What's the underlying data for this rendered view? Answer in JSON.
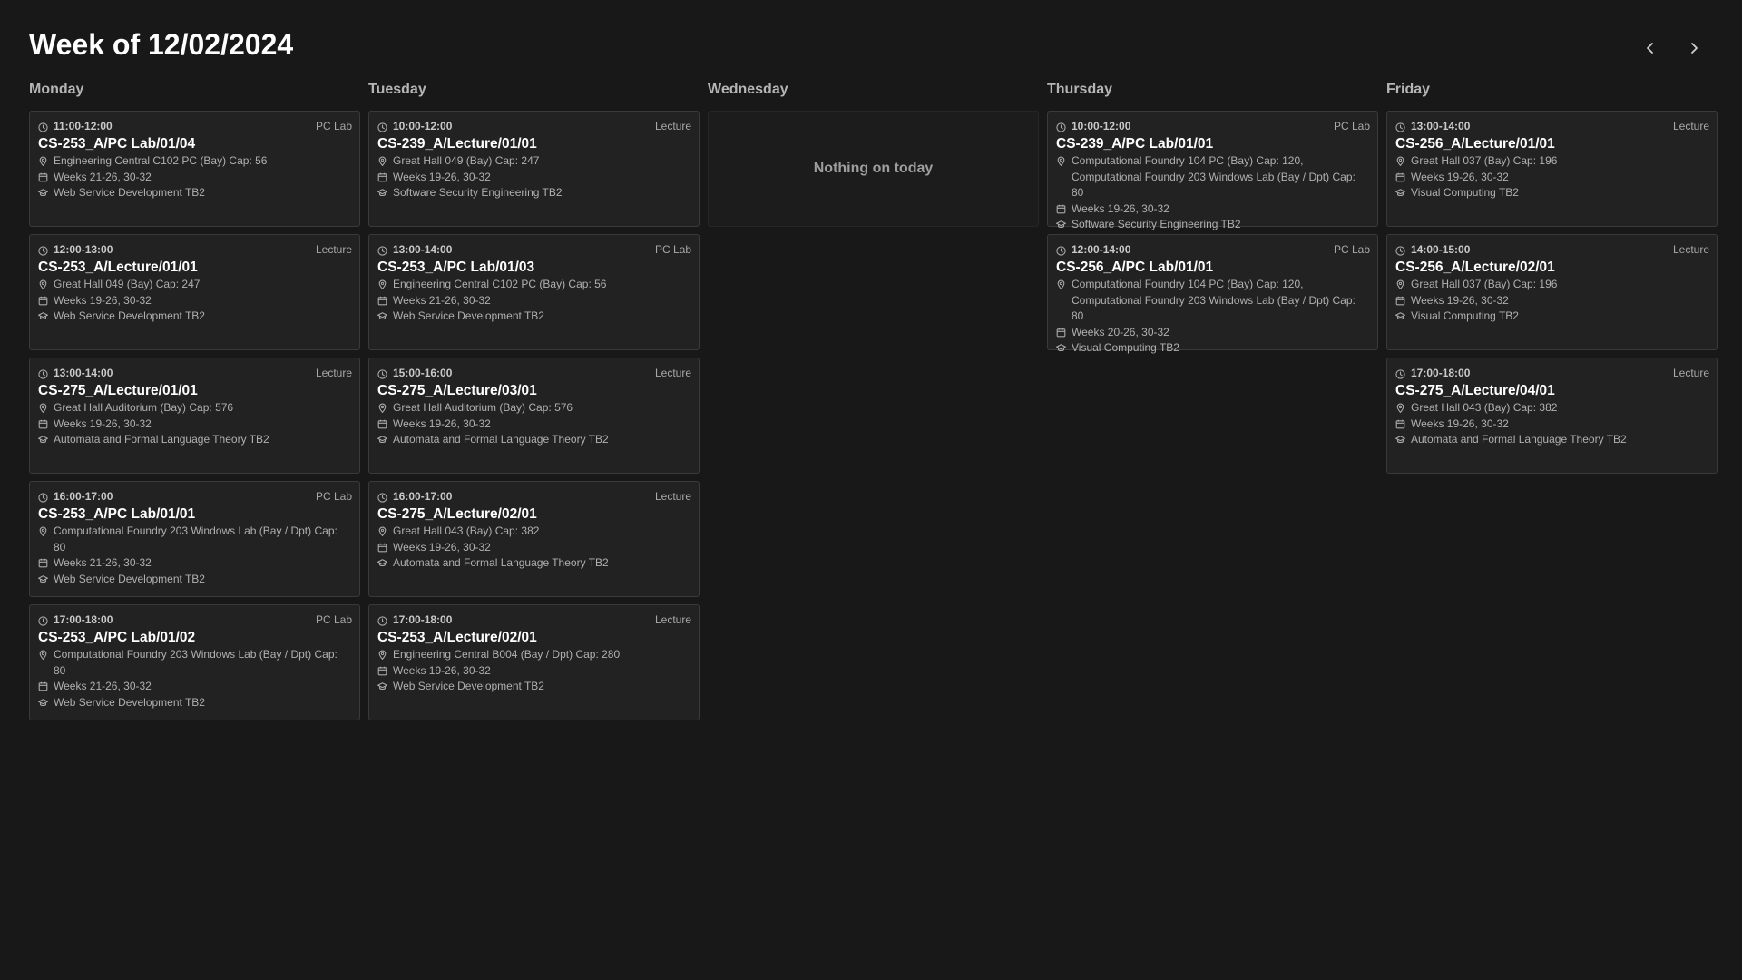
{
  "header": {
    "title": "Week of 12/02/2024",
    "prev_icon": "chevron-left-icon",
    "next_icon": "chevron-right-icon"
  },
  "days": [
    {
      "name": "Monday",
      "empty_text": "",
      "events": [
        {
          "time": "11:00-12:00",
          "type": "PC Lab",
          "code": "CS-253_A/PC Lab/01/04",
          "location": "Engineering Central C102 PC (Bay) Cap: 56",
          "weeks": "Weeks 21-26, 30-32",
          "module": "Web Service Development TB2"
        },
        {
          "time": "12:00-13:00",
          "type": "Lecture",
          "code": "CS-253_A/Lecture/01/01",
          "location": "Great Hall 049 (Bay) Cap: 247",
          "weeks": "Weeks 19-26, 30-32",
          "module": "Web Service Development TB2"
        },
        {
          "time": "13:00-14:00",
          "type": "Lecture",
          "code": "CS-275_A/Lecture/01/01",
          "location": "Great Hall Auditorium (Bay) Cap: 576",
          "weeks": "Weeks 19-26, 30-32",
          "module": "Automata and Formal Language Theory TB2"
        },
        {
          "time": "16:00-17:00",
          "type": "PC Lab",
          "code": "CS-253_A/PC Lab/01/01",
          "location": "Computational Foundry 203 Windows Lab (Bay / Dpt) Cap: 80",
          "weeks": "Weeks 21-26, 30-32",
          "module": "Web Service Development TB2"
        },
        {
          "time": "17:00-18:00",
          "type": "PC Lab",
          "code": "CS-253_A/PC Lab/01/02",
          "location": "Computational Foundry 203 Windows Lab (Bay / Dpt) Cap: 80",
          "weeks": "Weeks 21-26, 30-32",
          "module": "Web Service Development TB2"
        }
      ]
    },
    {
      "name": "Tuesday",
      "empty_text": "",
      "events": [
        {
          "time": "10:00-12:00",
          "type": "Lecture",
          "code": "CS-239_A/Lecture/01/01",
          "location": "Great Hall 049 (Bay) Cap: 247",
          "weeks": "Weeks 19-26, 30-32",
          "module": "Software Security Engineering TB2"
        },
        {
          "time": "13:00-14:00",
          "type": "PC Lab",
          "code": "CS-253_A/PC Lab/01/03",
          "location": "Engineering Central C102 PC (Bay) Cap: 56",
          "weeks": "Weeks 21-26, 30-32",
          "module": "Web Service Development TB2"
        },
        {
          "time": "15:00-16:00",
          "type": "Lecture",
          "code": "CS-275_A/Lecture/03/01",
          "location": "Great Hall Auditorium (Bay) Cap: 576",
          "weeks": "Weeks 19-26, 30-32",
          "module": "Automata and Formal Language Theory TB2"
        },
        {
          "time": "16:00-17:00",
          "type": "Lecture",
          "code": "CS-275_A/Lecture/02/01",
          "location": "Great Hall 043 (Bay) Cap: 382",
          "weeks": "Weeks 19-26, 30-32",
          "module": "Automata and Formal Language Theory TB2"
        },
        {
          "time": "17:00-18:00",
          "type": "Lecture",
          "code": "CS-253_A/Lecture/02/01",
          "location": "Engineering Central B004 (Bay / Dpt) Cap: 280",
          "weeks": "Weeks 19-26, 30-32",
          "module": "Web Service Development TB2"
        }
      ]
    },
    {
      "name": "Wednesday",
      "empty_text": "Nothing on today",
      "events": []
    },
    {
      "name": "Thursday",
      "empty_text": "",
      "events": [
        {
          "time": "10:00-12:00",
          "type": "PC Lab",
          "code": "CS-239_A/PC Lab/01/01",
          "location": "Computational Foundry 104 PC (Bay) Cap: 120, Computational Foundry 203 Windows Lab (Bay / Dpt) Cap: 80",
          "weeks": "Weeks 19-26, 30-32",
          "module": "Software Security Engineering TB2"
        },
        {
          "time": "12:00-14:00",
          "type": "PC Lab",
          "code": "CS-256_A/PC Lab/01/01",
          "location": "Computational Foundry 104 PC (Bay) Cap: 120, Computational Foundry 203 Windows Lab (Bay / Dpt) Cap: 80",
          "weeks": "Weeks 20-26, 30-32",
          "module": "Visual Computing TB2"
        }
      ]
    },
    {
      "name": "Friday",
      "empty_text": "",
      "events": [
        {
          "time": "13:00-14:00",
          "type": "Lecture",
          "code": "CS-256_A/Lecture/01/01",
          "location": "Great Hall 037 (Bay) Cap: 196",
          "weeks": "Weeks 19-26, 30-32",
          "module": "Visual Computing TB2"
        },
        {
          "time": "14:00-15:00",
          "type": "Lecture",
          "code": "CS-256_A/Lecture/02/01",
          "location": "Great Hall 037 (Bay) Cap: 196",
          "weeks": "Weeks 19-26, 30-32",
          "module": "Visual Computing TB2"
        },
        {
          "time": "17:00-18:00",
          "type": "Lecture",
          "code": "CS-275_A/Lecture/04/01",
          "location": "Great Hall 043 (Bay) Cap: 382",
          "weeks": "Weeks 19-26, 30-32",
          "module": "Automata and Formal Language Theory TB2"
        }
      ]
    }
  ]
}
